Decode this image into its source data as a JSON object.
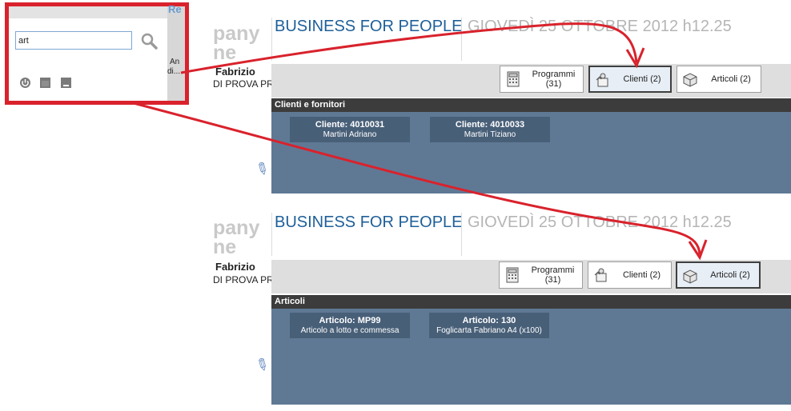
{
  "top_screen": {
    "logo_line1": "pany",
    "logo_line2": "ne",
    "company_title": "BUSINESS FOR PEOPLE",
    "date_text": "GIOVEDÌ 25 OTTOBRE 2012 h12.25",
    "user_name": "Fabrizio",
    "user_sub": "DI PROVA PR",
    "toolbar": {
      "programmi": "Programmi (31)",
      "clienti": "Clienti (2)",
      "articoli": "Articoli (2)",
      "active": "clienti"
    },
    "panel_title": "Clienti e fornitori",
    "cards": [
      {
        "title": "Cliente: 4010031",
        "subtitle": "Martini  Adriano"
      },
      {
        "title": "Cliente: 4010033",
        "subtitle": "Martini Tiziano"
      }
    ]
  },
  "bottom_screen": {
    "logo_line1": "pany",
    "logo_line2": "ne",
    "company_title": "BUSINESS FOR PEOPLE",
    "date_text": "GIOVEDÌ 25 OTTOBRE 2012 h12.25",
    "user_name": "Fabrizio",
    "user_sub": "DI PROVA PR",
    "toolbar": {
      "programmi": "Programmi (31)",
      "clienti": "Clienti (2)",
      "articoli": "Articoli (2)",
      "active": "articoli"
    },
    "panel_title": "Articoli",
    "cards": [
      {
        "title": "Articolo: MP99",
        "subtitle": "Articolo a lotto e commessa"
      },
      {
        "title": "Articolo: 130",
        "subtitle": "Foglicarta Fabriano A4 (x100)"
      }
    ]
  },
  "zoom": {
    "search_value": "art",
    "side_text_1": "Re",
    "side_text_2": "An",
    "side_text_3": "di..."
  },
  "colors": {
    "annotation_red": "#d9222c",
    "panel_blue": "#5f7995",
    "card_blue": "#485f78",
    "title_blue": "#1e5f99"
  },
  "icons": [
    "search-icon",
    "power-icon",
    "window-icon",
    "minimize-icon",
    "calculator-icon",
    "customer-icon",
    "box-icon",
    "pencil-icon"
  ]
}
